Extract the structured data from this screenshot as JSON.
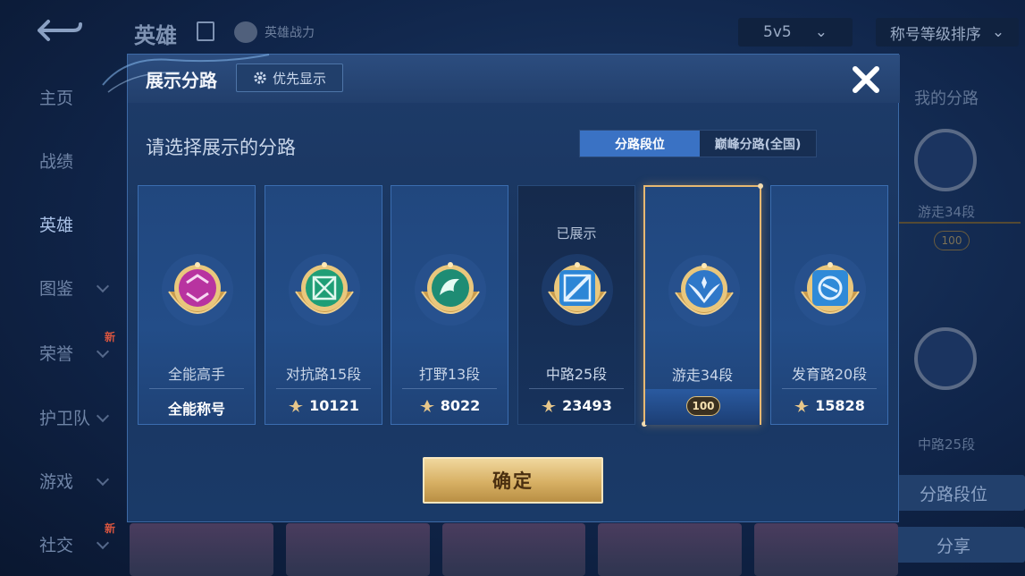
{
  "background": {
    "hero_title": "英雄",
    "hero_power": "英雄战力",
    "mode_select": "5v5",
    "sort_select": "称号等级排序",
    "nav": [
      "主页",
      "战绩",
      "英雄",
      "图鉴",
      "荣誉",
      "护卫队",
      "游戏",
      "社交"
    ],
    "nav_new_badge": "新",
    "right_panel": {
      "my_lane_title": "我的分路",
      "top_badge_label": "游走34段",
      "banner_number": "100",
      "bottom_badge_label": "中路25段",
      "lane_rank_button": "分路段位",
      "share_button": "分享"
    }
  },
  "dialog": {
    "title": "展示分路",
    "priority_button": "优先显示",
    "subtitle": "请选择展示的分路",
    "tabs": [
      {
        "label": "分路段位",
        "active": true
      },
      {
        "label": "巅峰分路(全国)",
        "active": false
      }
    ],
    "cards": [
      {
        "lane": "全能高手",
        "score": "全能称号",
        "status": "",
        "emblem_color": "#c23aa8",
        "kind": "title"
      },
      {
        "lane": "对抗路15段",
        "score": "10121",
        "status": "",
        "emblem_color": "#1f9e76",
        "kind": "score"
      },
      {
        "lane": "打野13段",
        "score": "8022",
        "status": "",
        "emblem_color": "#1e8c74",
        "kind": "score"
      },
      {
        "lane": "中路25段",
        "score": "23493",
        "status": "已展示",
        "emblem_color": "#2c86d6",
        "kind": "score"
      },
      {
        "lane": "游走34段",
        "score": "100",
        "status": "",
        "emblem_color": "#2f78c9",
        "kind": "banner"
      },
      {
        "lane": "发育路20段",
        "score": "15828",
        "status": "",
        "emblem_color": "#2f8ad8",
        "kind": "score"
      }
    ],
    "confirm_button": "确定",
    "colors": {
      "accent_gold": "#e7b872",
      "tab_active": "#3a72c4"
    }
  }
}
